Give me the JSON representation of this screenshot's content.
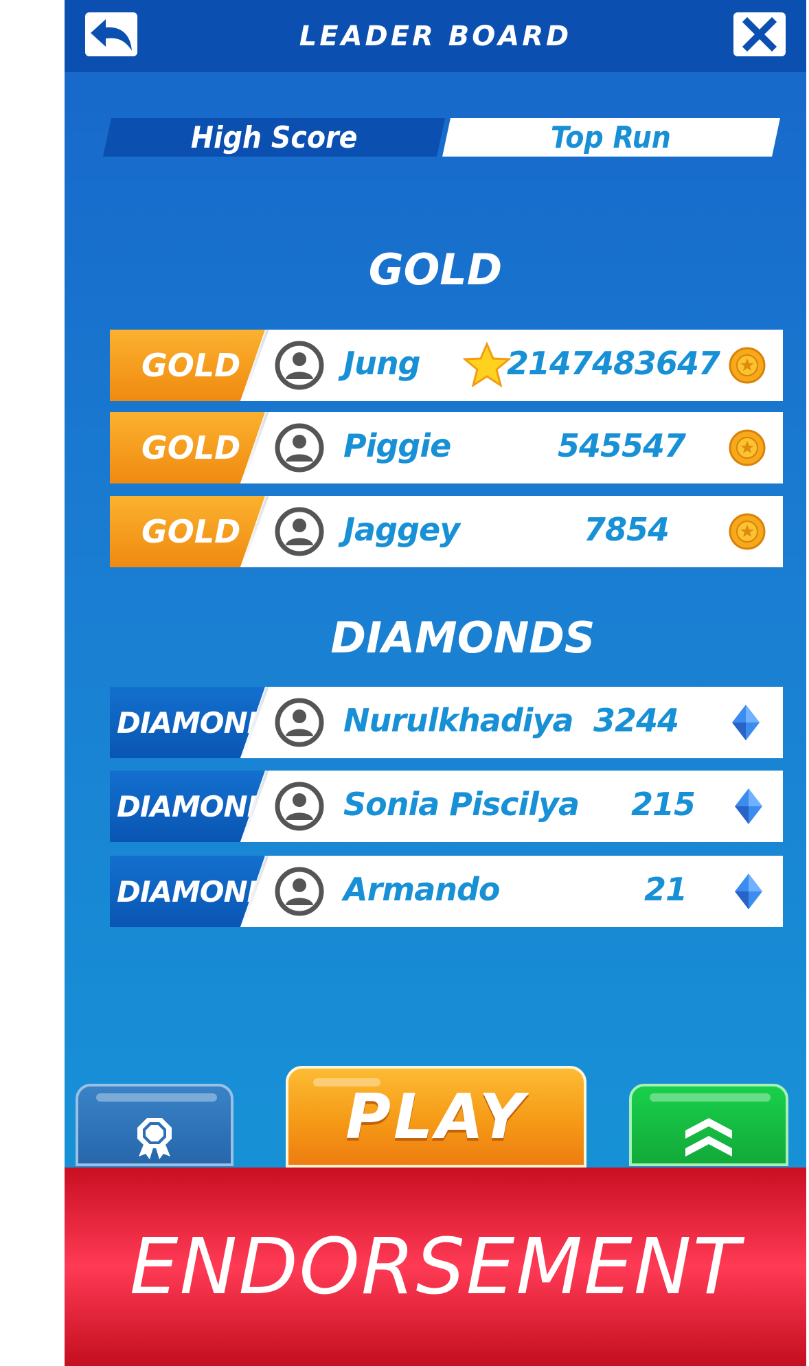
{
  "header": {
    "title": "LEADER BOARD"
  },
  "tabs": [
    {
      "label": "High Score",
      "active": true
    },
    {
      "label": "Top Run",
      "active": false
    }
  ],
  "sections": {
    "gold": {
      "title": "GOLD",
      "rows": [
        {
          "badge": "GOLD",
          "name": "Jung",
          "score": "2147483647",
          "star": true,
          "icon": "coin-icon"
        },
        {
          "badge": "GOLD",
          "name": "Piggie",
          "score": "545547",
          "star": false,
          "icon": "coin-icon"
        },
        {
          "badge": "GOLD",
          "name": "Jaggey",
          "score": "7854",
          "star": false,
          "icon": "coin-icon"
        }
      ]
    },
    "diamonds": {
      "title": "DIAMONDS",
      "rows": [
        {
          "badge": "DIAMOND",
          "name": "Nurulkhadiya",
          "score": "3244",
          "icon": "diamond-icon"
        },
        {
          "badge": "DIAMOND",
          "name": "Sonia Piscilya",
          "score": "215",
          "icon": "diamond-icon"
        },
        {
          "badge": "DIAMOND",
          "name": "Armando",
          "score": "21",
          "icon": "diamond-icon"
        }
      ]
    }
  },
  "buttons": {
    "play": "PLAY",
    "left_icon": "award-ribbon-icon",
    "right_icon": "double-chevron-up-icon"
  },
  "banner": {
    "text": "ENDORSEMENT"
  },
  "colors": {
    "header": "#0b4fb1",
    "accent": "#1890d6",
    "gold": "#f59a17",
    "play": "#f59a17",
    "green": "#12a93a",
    "banner": "#ff3a55"
  }
}
